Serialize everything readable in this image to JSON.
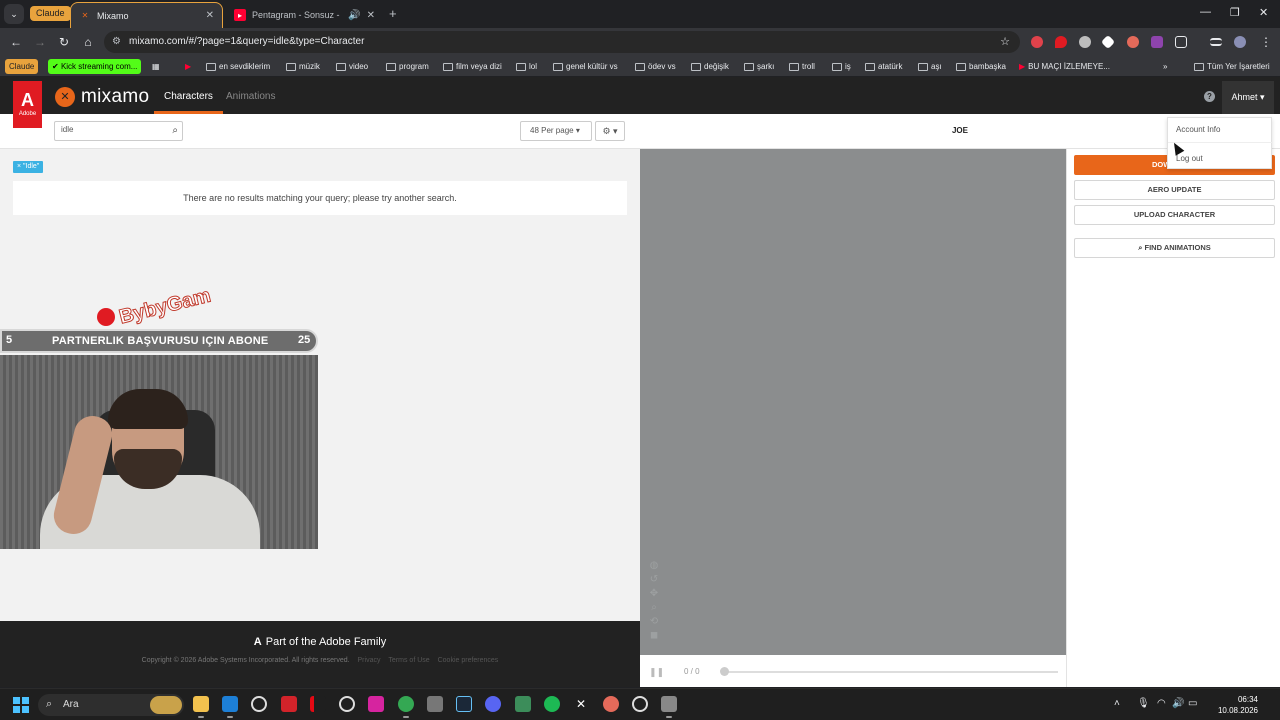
{
  "browser": {
    "tab_group_label": "Claude",
    "tabs": [
      {
        "title": "Mixamo",
        "icon": "mixamo-favicon",
        "active": true
      },
      {
        "title": "Pentagram - Sonsuz - YouTu",
        "icon": "youtube-favicon",
        "active": false
      }
    ],
    "url": "mixamo.com/#/?page=1&query=idle&type=Character",
    "bookmarks": [
      {
        "label": "Claude",
        "type": "chip"
      },
      {
        "label": "Kick streaming com...",
        "type": "chip"
      },
      {
        "label": "en sevdiklerim"
      },
      {
        "label": "müzik"
      },
      {
        "label": "video"
      },
      {
        "label": "program"
      },
      {
        "label": "film veya dizi"
      },
      {
        "label": "lol"
      },
      {
        "label": "genel kültür vs"
      },
      {
        "label": "ödev vs"
      },
      {
        "label": "değişik"
      },
      {
        "label": "şarkı"
      },
      {
        "label": "troll"
      },
      {
        "label": "iş"
      },
      {
        "label": "atatürk"
      },
      {
        "label": "aşı"
      },
      {
        "label": "bambaşka"
      },
      {
        "label": "BU MAÇI İZLEMEYE..."
      }
    ],
    "all_bookmarks_label": "Tüm Yer İşaretleri",
    "overflow_label": "»"
  },
  "mixamo": {
    "adobe_label": "Adobe",
    "logo_text": "mixamo",
    "nav": {
      "characters": "Characters",
      "animations": "Animations"
    },
    "user_name": "Ahmet",
    "help_symbol": "?",
    "search": {
      "value": "idle"
    },
    "per_page": "48 Per page",
    "filter_tag": "× \"Idle\"",
    "no_results": "There are no results matching your query; please try another search.",
    "character_name": "JOE",
    "buttons": {
      "download": "DOWNLOAD",
      "aero_update": "AERO UPDATE",
      "upload_character": "UPLOAD CHARACTER",
      "find_animations": "FIND ANIMATIONS"
    },
    "user_dropdown": {
      "account_info": "Account Info",
      "log_out": "Log out"
    },
    "player": {
      "frames": "0 / 0"
    },
    "footer": {
      "brand": "Part of the Adobe Family",
      "copyright": "Copyright © 2026 Adobe Systems Incorporated. All rights reserved.",
      "privacy": "Privacy",
      "terms": "Terms of Use",
      "cookies": "Cookie preferences"
    }
  },
  "stream_overlay": {
    "logo_text": "BybyGam",
    "banner_left": "5",
    "banner_text": "PARTNERLIK BAŞVURUSU IÇIN ABONE",
    "banner_right": "25"
  },
  "taskbar": {
    "search_label": "Ara",
    "time": "06:34",
    "date": "10.08.2026"
  },
  "colors": {
    "mixamo_orange": "#e8661a",
    "adobe_red": "#e01b22",
    "filter_blue": "#3bb2e3",
    "tab_group_orange": "#e8a33d"
  }
}
